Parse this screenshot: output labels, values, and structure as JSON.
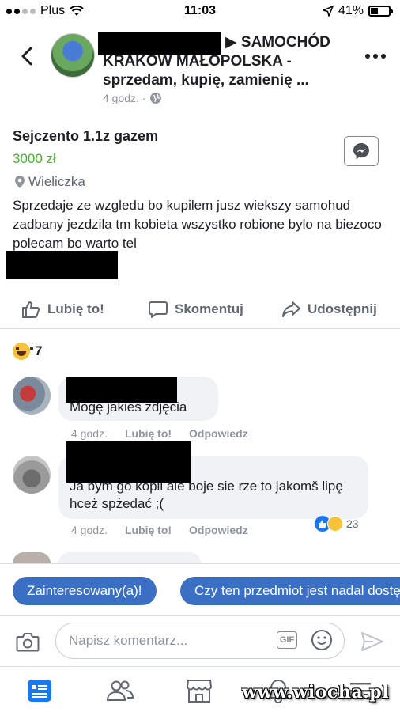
{
  "status_bar": {
    "carrier": "Plus",
    "time": "11:03",
    "battery_percent": "41%",
    "battery_level": 0.41
  },
  "header": {
    "group_title": "▶ SAMOCHÓD KRAKÓW MAŁOPOLSKA - sprzedam, kupię, zamienię ...",
    "time_ago": "4 godz. ·"
  },
  "post": {
    "title": "Sejczento 1.1z gazem",
    "price": "3000 zł",
    "location": "Wieliczka",
    "description": "Sprzedaje ze wzgledu bo kupilem jusz wiekszy samohud zadbany jezdzila tm kobieta wszystko robione bylo na biezoco polecam bo warto  tel"
  },
  "actions": {
    "like": "Lubię to!",
    "comment": "Skomentuj",
    "share": "Udostępnij"
  },
  "reactions": {
    "count": "7"
  },
  "comments": [
    {
      "text": "Mogę jakieś zdjęcia",
      "time": "4 godz.",
      "like_label": "Lubię to!",
      "reply_label": "Odpowiedz"
    },
    {
      "text": "Ja bym go kopil ale boje sie rze to jakomš lipę hceż spżedać ;(",
      "time": "4 godz.",
      "like_label": "Lubię to!",
      "reply_label": "Odpowiedz",
      "reaction_count": "23"
    }
  ],
  "quick_replies": [
    "Zainteresowany(a)!",
    "Czy ten przedmiot jest nadal dostępny?"
  ],
  "composer": {
    "placeholder": "Napisz komentarz...",
    "gif_label": "GIF"
  },
  "watermark": "www.wiocha.pl"
}
